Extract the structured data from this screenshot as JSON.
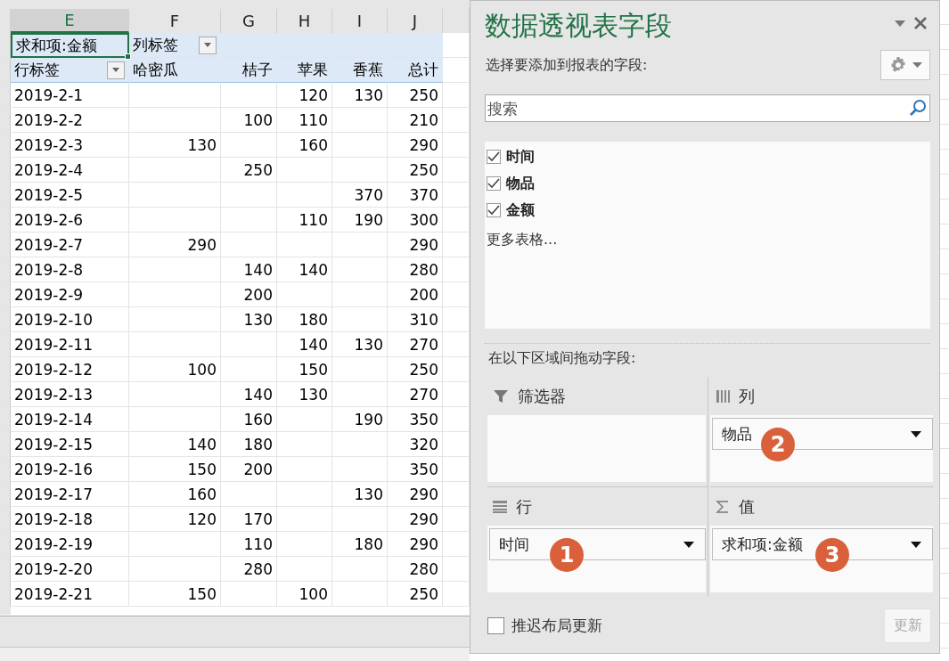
{
  "sheet": {
    "column_letters": [
      {
        "label": "E",
        "selected": true
      },
      {
        "label": "F",
        "selected": false
      },
      {
        "label": "G",
        "selected": false
      },
      {
        "label": "H",
        "selected": false
      },
      {
        "label": "I",
        "selected": false
      },
      {
        "label": "J",
        "selected": false
      }
    ],
    "pivot": {
      "value_header": "求和项:金额",
      "column_labels": "列标签",
      "row_labels": "行标签",
      "columns": [
        "哈密瓜",
        "桔子",
        "苹果",
        "香蕉",
        "总计"
      ],
      "rows": [
        {
          "label": "2019-2-1",
          "column_h": "120",
          "column_i": "130",
          "column_j": "250"
        },
        {
          "label": "2019-2-2",
          "column_g": "100",
          "column_h": "110",
          "column_j": "210"
        },
        {
          "label": "2019-2-3",
          "column_f": "130",
          "column_h": "160",
          "column_j": "290"
        },
        {
          "label": "2019-2-4",
          "column_g": "250",
          "column_j": "250"
        },
        {
          "label": "2019-2-5",
          "column_i": "370",
          "column_j": "370"
        },
        {
          "label": "2019-2-6",
          "column_h": "110",
          "column_i": "190",
          "column_j": "300"
        },
        {
          "label": "2019-2-7",
          "column_f": "290",
          "column_j": "290"
        },
        {
          "label": "2019-2-8",
          "column_g": "140",
          "column_h": "140",
          "column_j": "280"
        },
        {
          "label": "2019-2-9",
          "column_g": "200",
          "column_j": "200"
        },
        {
          "label": "2019-2-10",
          "column_g": "130",
          "column_h": "180",
          "column_j": "310"
        },
        {
          "label": "2019-2-11",
          "column_h": "140",
          "column_i": "130",
          "column_j": "270"
        },
        {
          "label": "2019-2-12",
          "column_f": "100",
          "column_h": "150",
          "column_j": "250"
        },
        {
          "label": "2019-2-13",
          "column_g": "140",
          "column_h": "130",
          "column_j": "270"
        },
        {
          "label": "2019-2-14",
          "column_g": "160",
          "column_i": "190",
          "column_j": "350"
        },
        {
          "label": "2019-2-15",
          "column_f": "140",
          "column_g": "180",
          "column_j": "320"
        },
        {
          "label": "2019-2-16",
          "column_f": "150",
          "column_g": "200",
          "column_j": "350"
        },
        {
          "label": "2019-2-17",
          "column_f": "160",
          "column_i": "130",
          "column_j": "290"
        },
        {
          "label": "2019-2-18",
          "column_f": "120",
          "column_g": "170",
          "column_j": "290"
        },
        {
          "label": "2019-2-19",
          "column_g": "110",
          "column_i": "180",
          "column_j": "290"
        },
        {
          "label": "2019-2-20",
          "column_g": "280",
          "column_j": "280"
        },
        {
          "label": "2019-2-21",
          "column_f": "150",
          "column_h": "100",
          "column_j": "250"
        }
      ]
    }
  },
  "pane": {
    "title": "数据透视表字段",
    "subtitle": "选择要添加到报表的字段:",
    "search": {
      "placeholder": "搜索"
    },
    "fields": [
      {
        "label": "时间",
        "checked": true
      },
      {
        "label": "物品",
        "checked": true
      },
      {
        "label": "金额",
        "checked": true
      }
    ],
    "more_tables": "更多表格...",
    "drag_hint": "在以下区域间拖动字段:",
    "areas": [
      {
        "kind": "filter",
        "label": "筛选器"
      },
      {
        "kind": "columns",
        "label": "列",
        "items": [
          {
            "label": "物品",
            "badge": "2"
          }
        ]
      },
      {
        "kind": "rows",
        "label": "行",
        "items": [
          {
            "label": "时间",
            "badge": "1"
          }
        ]
      },
      {
        "kind": "values",
        "label": "值",
        "items": [
          {
            "label": "求和项:金额",
            "badge": "3"
          }
        ]
      }
    ],
    "defer_update": {
      "label": "推迟布局更新",
      "checked": false
    },
    "update_button": {
      "label": "更新",
      "disabled": true
    }
  }
}
